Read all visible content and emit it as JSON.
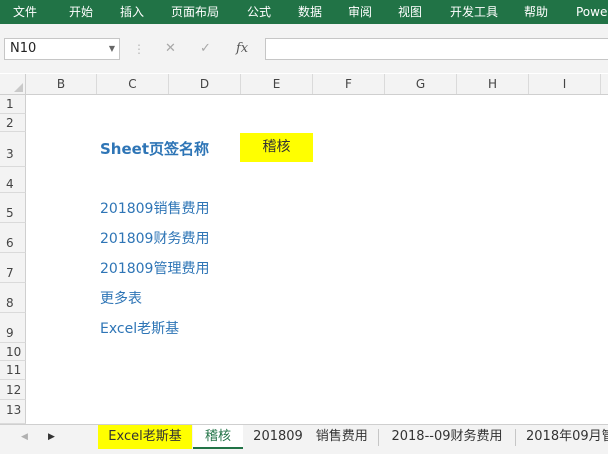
{
  "ribbon": {
    "tabs": [
      "文件",
      "开始",
      "插入",
      "页面布局",
      "公式",
      "数据",
      "审阅",
      "视图",
      "开发工具",
      "帮助",
      "Powe"
    ]
  },
  "formula_bar": {
    "name_box": "N10",
    "cancel_icon": "✕",
    "enter_icon": "✓",
    "fx_label": "fx",
    "formula": ""
  },
  "columns": [
    "B",
    "C",
    "D",
    "E",
    "F",
    "G",
    "H",
    "I"
  ],
  "rows": [
    "1",
    "2",
    "3",
    "4",
    "5",
    "6",
    "7",
    "8",
    "9",
    "10",
    "11",
    "12",
    "13"
  ],
  "cells": {
    "title": "Sheet页签名称",
    "highlight": "稽核",
    "links": [
      "201809销售费用",
      "201809财务费用",
      "201809管理费用",
      "更多表",
      "Excel老斯基"
    ]
  },
  "sheet_tabs": {
    "tabs": [
      "Excel老斯基",
      "稽核",
      "201809　销售费用",
      "2018--09财务费用",
      "2018年09月管"
    ],
    "active_index": 1
  },
  "colors": {
    "ribbon": "#217346",
    "link_text": "#2e75b6",
    "highlight_fill": "#ffff00"
  }
}
